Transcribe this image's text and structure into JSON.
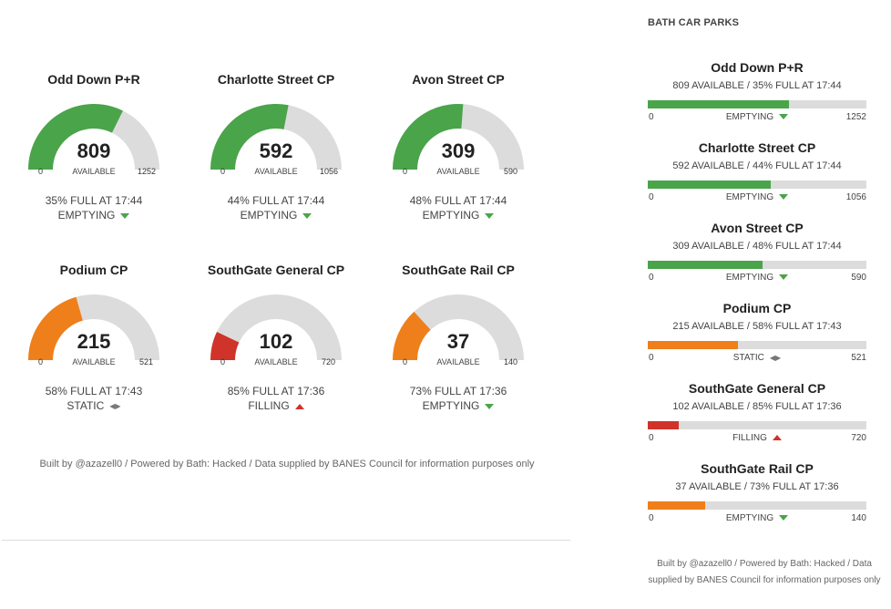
{
  "colors": {
    "green": "#4aa44a",
    "orange": "#ef7f1a",
    "red": "#d0332a",
    "track": "#dcdcdc"
  },
  "gauges": [
    {
      "name": "Odd Down P+R",
      "value": "809",
      "available_label": "AVAILABLE",
      "min": "0",
      "max": "1252",
      "capacity": 1252,
      "percent_full": 35,
      "color": "#4aa44a",
      "full_text": "35% FULL AT 17:44",
      "trend": "EMPTYING",
      "trend_icon": "down"
    },
    {
      "name": "Charlotte Street CP",
      "value": "592",
      "available_label": "AVAILABLE",
      "min": "0",
      "max": "1056",
      "capacity": 1056,
      "percent_full": 44,
      "color": "#4aa44a",
      "full_text": "44% FULL AT 17:44",
      "trend": "EMPTYING",
      "trend_icon": "down"
    },
    {
      "name": "Avon Street CP",
      "value": "309",
      "available_label": "AVAILABLE",
      "min": "0",
      "max": "590",
      "capacity": 590,
      "percent_full": 48,
      "color": "#4aa44a",
      "full_text": "48% FULL AT 17:44",
      "trend": "EMPTYING",
      "trend_icon": "down"
    },
    {
      "name": "Podium CP",
      "value": "215",
      "available_label": "AVAILABLE",
      "min": "0",
      "max": "521",
      "capacity": 521,
      "percent_full": 58,
      "color": "#ef7f1a",
      "full_text": "58% FULL AT 17:43",
      "trend": "STATIC",
      "trend_icon": "static"
    },
    {
      "name": "SouthGate General CP",
      "value": "102",
      "available_label": "AVAILABLE",
      "min": "0",
      "max": "720",
      "capacity": 720,
      "percent_full": 85,
      "color": "#d0332a",
      "full_text": "85% FULL AT 17:36",
      "trend": "FILLING",
      "trend_icon": "up"
    },
    {
      "name": "SouthGate Rail CP",
      "value": "37",
      "available_label": "AVAILABLE",
      "min": "0",
      "max": "140",
      "capacity": 140,
      "percent_full": 73,
      "color": "#ef7f1a",
      "full_text": "73% FULL AT 17:36",
      "trend": "EMPTYING",
      "trend_icon": "down"
    }
  ],
  "main_footer": "Built by @azazell0 / Powered by Bath: Hacked / Data supplied by BANES Council for information purposes only",
  "sidebar": {
    "heading": "BATH CAR PARKS",
    "items": [
      {
        "name": "Odd Down P+R",
        "info": "809 AVAILABLE / 35% FULL AT 17:44",
        "min": "0",
        "max": "1252",
        "available_fraction": 0.646,
        "color": "#4aa44a",
        "trend": "EMPTYING",
        "trend_icon": "down"
      },
      {
        "name": "Charlotte Street CP",
        "info": "592 AVAILABLE / 44% FULL AT 17:44",
        "min": "0",
        "max": "1056",
        "available_fraction": 0.561,
        "color": "#4aa44a",
        "trend": "EMPTYING",
        "trend_icon": "down"
      },
      {
        "name": "Avon Street CP",
        "info": "309 AVAILABLE / 48% FULL AT 17:44",
        "min": "0",
        "max": "590",
        "available_fraction": 0.524,
        "color": "#4aa44a",
        "trend": "EMPTYING",
        "trend_icon": "down"
      },
      {
        "name": "Podium CP",
        "info": "215 AVAILABLE / 58% FULL AT 17:43",
        "min": "0",
        "max": "521",
        "available_fraction": 0.413,
        "color": "#ef7f1a",
        "trend": "STATIC",
        "trend_icon": "static"
      },
      {
        "name": "SouthGate General CP",
        "info": "102 AVAILABLE / 85% FULL AT 17:36",
        "min": "0",
        "max": "720",
        "available_fraction": 0.142,
        "color": "#d0332a",
        "trend": "FILLING",
        "trend_icon": "up"
      },
      {
        "name": "SouthGate Rail CP",
        "info": "37 AVAILABLE / 73% FULL AT 17:36",
        "min": "0",
        "max": "140",
        "available_fraction": 0.264,
        "color": "#ef7f1a",
        "trend": "EMPTYING",
        "trend_icon": "down"
      }
    ],
    "footer": "Built by @azazell0 / Powered by Bath: Hacked / Data supplied by BANES Council for information purposes only"
  }
}
